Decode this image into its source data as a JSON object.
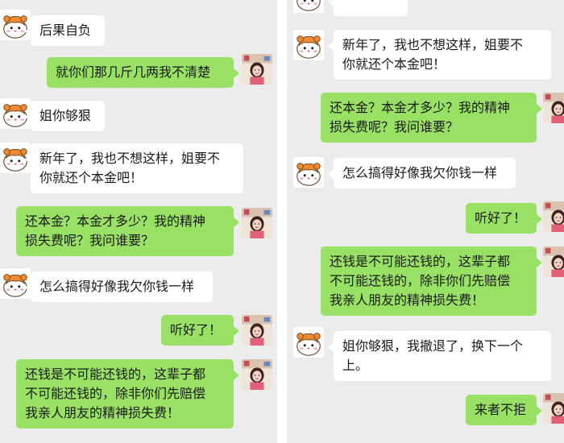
{
  "left": {
    "messages": [
      {
        "from": "them",
        "text": "后果自负"
      },
      {
        "from": "me",
        "text": "就你们那几斤几两我不清楚"
      },
      {
        "from": "them",
        "text": "姐你够狠"
      },
      {
        "from": "them",
        "line1": "新年了，我也不想这样，姐要不",
        "line2": "你就还个本金吧！"
      },
      {
        "from": "me",
        "line1": "还本金？本金才多少？我的精神",
        "line2": "损失费呢？我问谁要？"
      },
      {
        "from": "them",
        "text": "怎么搞得好像我欠你钱一样"
      },
      {
        "from": "me",
        "text": "听好了！"
      },
      {
        "from": "me",
        "line1": "还钱是不可能还钱的，这辈子都",
        "line2": "不可能还钱的，除非你们先赔偿",
        "line3": "我亲人朋友的精神损失费！"
      }
    ]
  },
  "right": {
    "messages": [
      {
        "from": "them",
        "line1": "新年了，我也不想这样，姐要不",
        "line2": "你就还个本金吧！"
      },
      {
        "from": "me",
        "line1": "还本金？本金才多少？我的精神",
        "line2": "损失费呢？我问谁要？"
      },
      {
        "from": "them",
        "text": "怎么搞得好像我欠你钱一样"
      },
      {
        "from": "me",
        "text": "听好了！"
      },
      {
        "from": "me",
        "line1": "还钱是不可能还钱的，这辈子都",
        "line2": "不可能还钱的，除非你们先赔偿",
        "line3": "我亲人朋友的精神损失费！"
      },
      {
        "from": "them",
        "line1": "姐你够狠，我撤退了，换下一个",
        "line2": "上。"
      },
      {
        "from": "me",
        "text": "来者不拒"
      }
    ]
  },
  "colors": {
    "background": "#ececec",
    "outgoing_bubble": "#98e165",
    "incoming_bubble": "#ffffff"
  },
  "icons": {
    "contact_avatar": "hamster-avatar-icon",
    "user_avatar": "girl-photo-avatar-icon"
  }
}
